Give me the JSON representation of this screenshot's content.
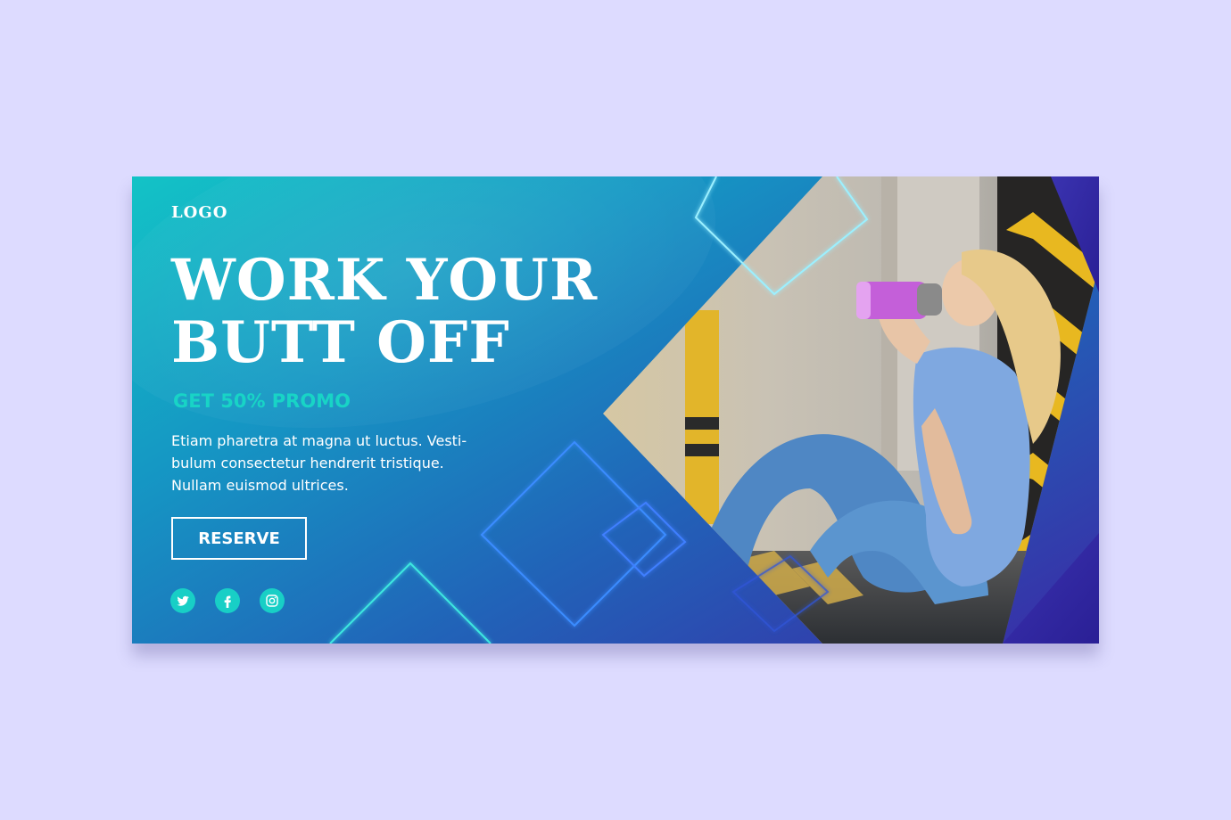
{
  "banner": {
    "logo": "LOGO",
    "headline_line1": "WORK YOUR",
    "headline_line2": "BUTT OFF",
    "promo": "GET 50% PROMO",
    "body_line1": "Etiam pharetra at magna ut luctus. Vesti-",
    "body_line2": "bulum consectetur hendrerit tristique.",
    "body_line3": "Nullam euismod ultrices.",
    "cta_label": "RESERVE"
  },
  "social": [
    {
      "icon": "twitter-icon"
    },
    {
      "icon": "facebook-icon"
    },
    {
      "icon": "instagram-icon"
    }
  ],
  "colors": {
    "page_background": "#dddbff",
    "gradient_start": "#13c3c6",
    "gradient_end": "#3a2ba6",
    "accent": "#18d4c6",
    "text": "#ffffff"
  }
}
